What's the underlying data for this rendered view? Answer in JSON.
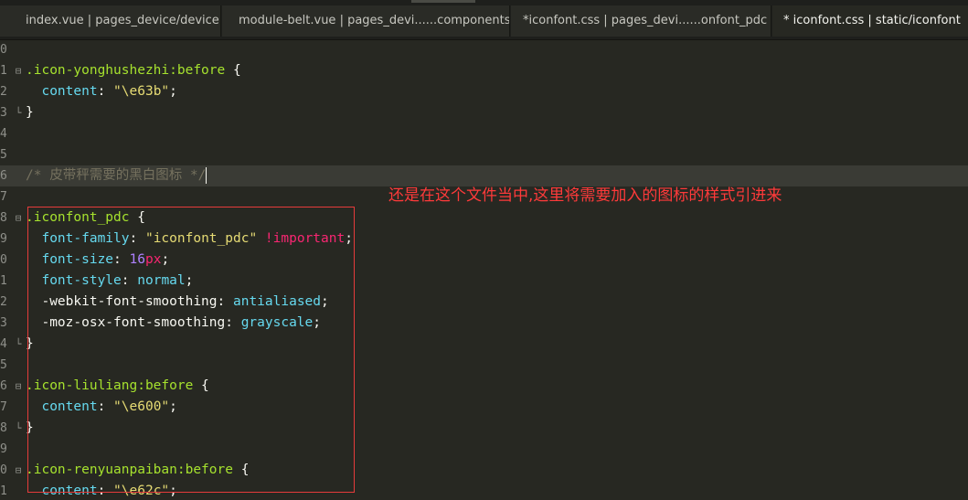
{
  "tabs": [
    {
      "label": "index.vue | pages_device/device"
    },
    {
      "label": "module-belt.vue | pages_devi......components"
    },
    {
      "label": "*iconfont.css | pages_devi......onfont_pdc"
    },
    {
      "label": "* iconfont.css | static/iconfont"
    }
  ],
  "annotation": {
    "text": "还是在这个文件当中,这里将需要加入的图标的样式引进来"
  },
  "lines": [
    {
      "num": "0",
      "fold": ""
    },
    {
      "num": "1",
      "fold": "⊟",
      "segs": [
        [
          ".icon-yonghushezhi:before",
          "sel"
        ],
        [
          " {",
          "punc"
        ]
      ]
    },
    {
      "num": "2",
      "fold": "",
      "segs": [
        [
          "  ",
          "punc"
        ],
        [
          "content",
          "prop"
        ],
        [
          ": ",
          "punc"
        ],
        [
          "\"\\e63b\"",
          "str"
        ],
        [
          ";",
          "punc"
        ]
      ]
    },
    {
      "num": "3",
      "fold": "└",
      "segs": [
        [
          "}",
          "punc"
        ]
      ]
    },
    {
      "num": "4",
      "fold": ""
    },
    {
      "num": "5",
      "fold": ""
    },
    {
      "num": "6",
      "fold": "",
      "current": true,
      "segs": [
        [
          "/* 皮带秤需要的黑白图标 */",
          "cmt"
        ]
      ]
    },
    {
      "num": "7",
      "fold": ""
    },
    {
      "num": "8",
      "fold": "⊟",
      "segs": [
        [
          ".iconfont_pdc",
          "sel"
        ],
        [
          " {",
          "punc"
        ]
      ]
    },
    {
      "num": "9",
      "fold": "",
      "segs": [
        [
          "  ",
          "punc"
        ],
        [
          "font-family",
          "prop"
        ],
        [
          ": ",
          "punc"
        ],
        [
          "\"iconfont_pdc\"",
          "str"
        ],
        [
          " ",
          "punc"
        ],
        [
          "!important",
          "imp"
        ],
        [
          ";",
          "punc"
        ]
      ]
    },
    {
      "num": "0",
      "fold": "",
      "segs": [
        [
          "  ",
          "punc"
        ],
        [
          "font-size",
          "prop"
        ],
        [
          ": ",
          "punc"
        ],
        [
          "16",
          "num"
        ],
        [
          "px",
          "unit"
        ],
        [
          ";",
          "punc"
        ]
      ]
    },
    {
      "num": "1",
      "fold": "",
      "segs": [
        [
          "  ",
          "punc"
        ],
        [
          "font-style",
          "prop"
        ],
        [
          ": ",
          "punc"
        ],
        [
          "normal",
          "kw"
        ],
        [
          ";",
          "punc"
        ]
      ]
    },
    {
      "num": "2",
      "fold": "",
      "segs": [
        [
          "  -webkit-font-smoothing: ",
          "punc"
        ],
        [
          "antialiased",
          "kw"
        ],
        [
          ";",
          "punc"
        ]
      ]
    },
    {
      "num": "3",
      "fold": "",
      "segs": [
        [
          "  -moz-osx-font-smoothing: ",
          "punc"
        ],
        [
          "grayscale",
          "kw"
        ],
        [
          ";",
          "punc"
        ]
      ]
    },
    {
      "num": "4",
      "fold": "└",
      "segs": [
        [
          "}",
          "punc"
        ]
      ]
    },
    {
      "num": "5",
      "fold": ""
    },
    {
      "num": "6",
      "fold": "⊟",
      "segs": [
        [
          ".icon-liuliang:before",
          "sel"
        ],
        [
          " {",
          "punc"
        ]
      ]
    },
    {
      "num": "7",
      "fold": "",
      "segs": [
        [
          "  ",
          "punc"
        ],
        [
          "content",
          "prop"
        ],
        [
          ": ",
          "punc"
        ],
        [
          "\"\\e600\"",
          "str"
        ],
        [
          ";",
          "punc"
        ]
      ]
    },
    {
      "num": "8",
      "fold": "└",
      "segs": [
        [
          "}",
          "punc"
        ]
      ]
    },
    {
      "num": "9",
      "fold": ""
    },
    {
      "num": "0",
      "fold": "⊟",
      "segs": [
        [
          ".icon-renyuanpaiban:before",
          "sel"
        ],
        [
          " {",
          "punc"
        ]
      ]
    },
    {
      "num": "1",
      "fold": "",
      "segs": [
        [
          "  ",
          "punc"
        ],
        [
          "content",
          "prop"
        ],
        [
          ": ",
          "punc"
        ],
        [
          "\"\\e62c\"",
          "str"
        ],
        [
          ";",
          "punc"
        ]
      ]
    }
  ],
  "colors": {
    "background": "#272822",
    "annotation": "#ff3a3a",
    "highlight_box": "#e53b3b"
  }
}
